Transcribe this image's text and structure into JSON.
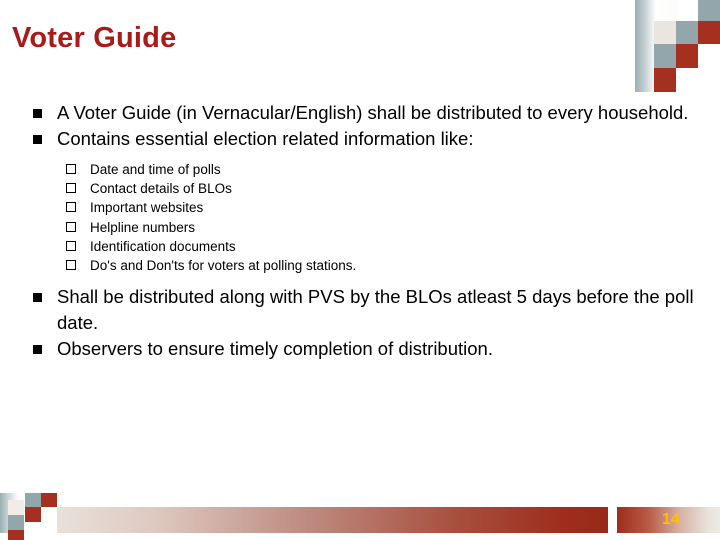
{
  "slide": {
    "title": "Voter Guide",
    "slide_number": "14",
    "title_color": "#a91b18",
    "accent_red": "#a5301f",
    "accent_grey": "#93a6ab",
    "accent_cream": "#eae5de",
    "slide_number_color": "#ffc000"
  },
  "content": {
    "bullets": [
      {
        "text": "A Voter Guide (in Vernacular/English) shall be distributed to every household.",
        "marker": "filled-square"
      },
      {
        "text": "Contains essential election related information like:",
        "marker": "filled-square"
      },
      {
        "text": "Shall be distributed along with PVS by the BLOs atleast 5 days before the poll date.",
        "marker": "filled-square"
      },
      {
        "text": "Observers to ensure timely completion of distribution.",
        "marker": "filled-square"
      }
    ],
    "sub_bullets": [
      {
        "text": "Date and time of polls",
        "marker": "hollow-square"
      },
      {
        "text": "Contact details of BLOs",
        "marker": "hollow-square"
      },
      {
        "text": "Important websites",
        "marker": "hollow-square"
      },
      {
        "text": "Helpline numbers",
        "marker": "hollow-square"
      },
      {
        "text": "Identification documents",
        "marker": "hollow-square"
      },
      {
        "text": "Do's and Don'ts for voters at polling stations.",
        "marker": "hollow-square"
      }
    ]
  }
}
